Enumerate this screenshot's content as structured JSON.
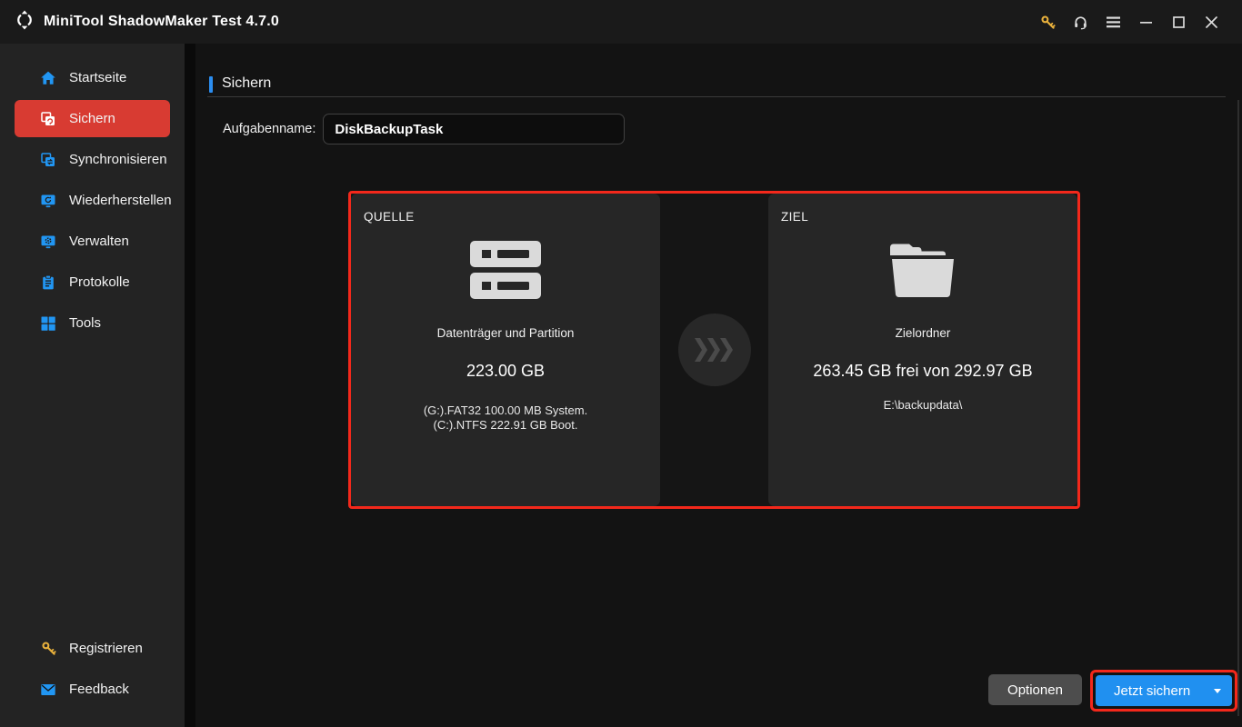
{
  "titlebar": {
    "title": "MiniTool ShadowMaker Test 4.7.0",
    "icons": [
      "app-logo",
      "key-icon",
      "headset-icon",
      "hamburger-menu-icon",
      "minimize-icon",
      "maximize-icon",
      "close-icon"
    ]
  },
  "sidebar": {
    "items": [
      {
        "label": "Startseite",
        "icon": "home-icon",
        "active": false
      },
      {
        "label": "Sichern",
        "icon": "backup-icon",
        "active": true
      },
      {
        "label": "Synchronisieren",
        "icon": "sync-icon",
        "active": false
      },
      {
        "label": "Wiederherstellen",
        "icon": "restore-icon",
        "active": false
      },
      {
        "label": "Verwalten",
        "icon": "manage-icon",
        "active": false
      },
      {
        "label": "Protokolle",
        "icon": "logs-icon",
        "active": false
      },
      {
        "label": "Tools",
        "icon": "tools-icon",
        "active": false
      }
    ],
    "footer_items": [
      {
        "label": "Registrieren",
        "icon": "key-icon"
      },
      {
        "label": "Feedback",
        "icon": "envelope-icon"
      }
    ]
  },
  "main": {
    "page_title": "Sichern",
    "task_name_label": "Aufgabenname:",
    "task_name_value": "DiskBackupTask",
    "source_card": {
      "heading": "QUELLE",
      "icon": "disk-icon",
      "type_label": "Datenträger und Partition",
      "size": "223.00 GB",
      "details": [
        "(G:).FAT32 100.00 MB System.",
        "(C:).NTFS 222.91 GB Boot."
      ]
    },
    "destination_card": {
      "heading": "ZIEL",
      "icon": "folder-icon",
      "type_label": "Zielordner",
      "size": "263.45 GB frei von 292.97 GB",
      "path": "E:\\backupdata\\"
    },
    "footer": {
      "options_label": "Optionen",
      "backup_now_label": "Jetzt sichern"
    }
  },
  "colors": {
    "accent_red": "#d83b32",
    "highlight_red": "#f3281b",
    "accent_blue": "#2196f3",
    "button_blue": "#2090f0",
    "gray_button": "#4d4d4d",
    "key_gold": "#e9b13c",
    "sidebar_bg": "#232323",
    "main_bg": "#131313",
    "card_bg": "#262626",
    "titlebar_bg": "#1a1a1a"
  }
}
